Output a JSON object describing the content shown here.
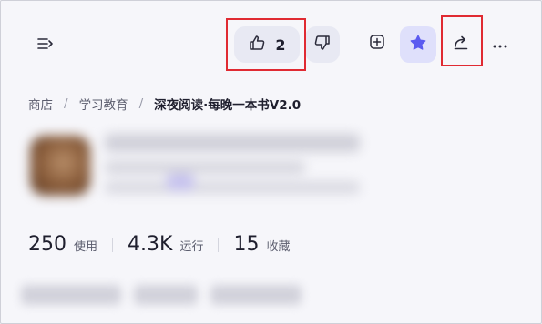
{
  "toolbar": {
    "menu_icon": "menu-expand-icon",
    "like_count": "2",
    "like_icon": "thumbs-up-icon",
    "dislike_icon": "thumbs-down-icon",
    "add_icon": "plus-square-icon",
    "favorite_icon": "star-icon",
    "share_icon": "share-icon",
    "more_icon": "more-horizontal-icon",
    "accent_color": "#5b5bf0",
    "highlight_color": "#e02a32"
  },
  "breadcrumb": {
    "items": [
      "商店",
      "学习教育"
    ],
    "separator": "/",
    "current": "深夜阅读·每晚一本书V2.0"
  },
  "stats": [
    {
      "value": "250",
      "label": "使用"
    },
    {
      "value": "4.3K",
      "label": "运行"
    },
    {
      "value": "15",
      "label": "收藏"
    }
  ]
}
